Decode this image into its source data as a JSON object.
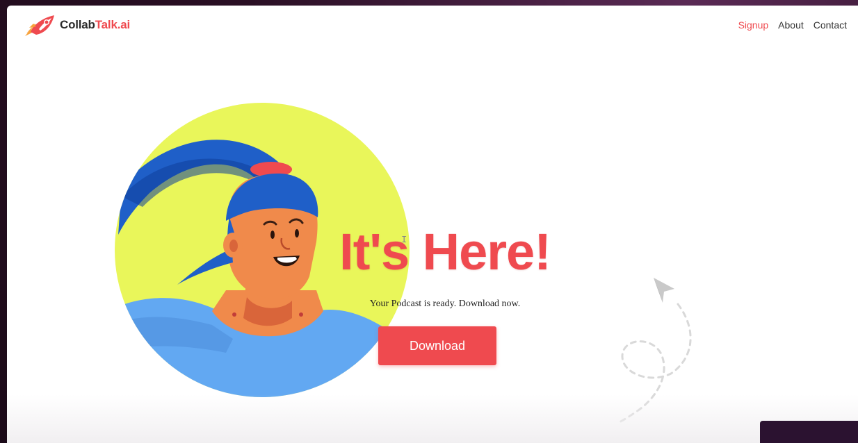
{
  "brand": {
    "name_prefix": "Collab",
    "name_suffix": "Talk.ai",
    "icon": "rocket-icon",
    "accent_color": "#ef4a4f"
  },
  "nav": {
    "items": [
      {
        "label": "Signup",
        "active": true
      },
      {
        "label": "About",
        "active": false
      },
      {
        "label": "Contact",
        "active": false
      }
    ]
  },
  "hero": {
    "headline": "It's Here!",
    "subtitle": "Your Podcast is ready. Download now.",
    "download_label": "Download",
    "illustration": "woman-with-ponytail-illustration"
  },
  "decorations": {
    "paper-plane": "paper-plane-icon"
  }
}
